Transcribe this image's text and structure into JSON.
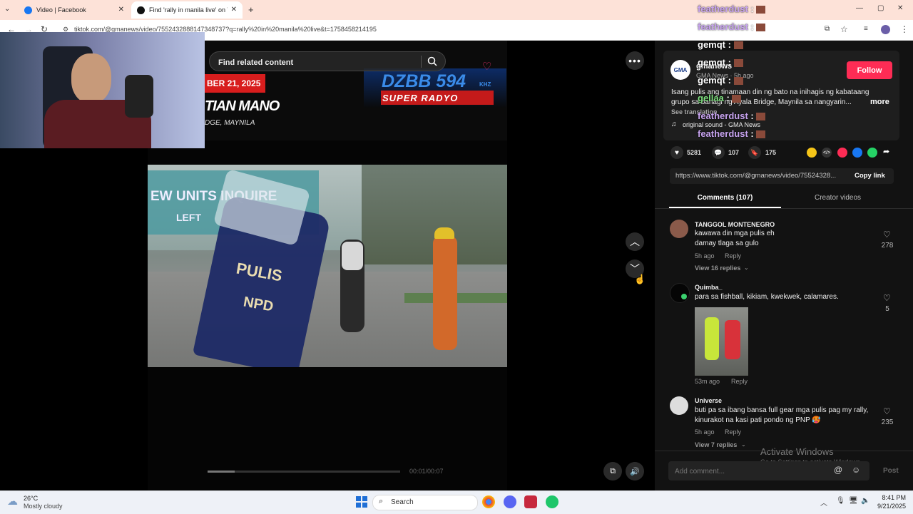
{
  "browser": {
    "tabs": [
      {
        "title": "Video | Facebook",
        "active": false
      },
      {
        "title": "Find 'rally in manila live' on TikTok",
        "active": true
      }
    ],
    "url": "tiktok.com/@gmanews/video/7552432888147348737?q=rally%20in%20manila%20live&t=1758458214195"
  },
  "video": {
    "search_placeholder": "Find related content",
    "overlay": {
      "date": "BER 21, 2025",
      "name": "TIAN MANO",
      "place": "DGE, MAYNILA",
      "station": "DZBB 594",
      "station_suffix": "KHZ",
      "station_sub": "SUPER RADYO"
    },
    "signs": {
      "store": "EW UNITS  INQUIRE",
      "store2": "LEFT",
      "shield": "PULIS",
      "badge": "NPD"
    },
    "time": "00:01/00:07"
  },
  "chat_overlay": [
    {
      "user": "featherdust",
      "color": "#c8a4f0"
    },
    {
      "user": "featherdust",
      "color": "#c8a4f0"
    },
    {
      "user": "gemqt",
      "color": "#ffffff"
    },
    {
      "user": "gemqt",
      "color": "#ffffff"
    },
    {
      "user": "gemqt",
      "color": "#ffffff"
    },
    {
      "user": "gellaa",
      "color": "#7ee07e"
    },
    {
      "user": "featherdust",
      "color": "#c8a4f0"
    },
    {
      "user": "featherdust",
      "color": "#c8a4f0"
    }
  ],
  "post": {
    "author": "gmanews",
    "author_sub": "GMA News · 5h ago",
    "follow_label": "Follow",
    "caption": "Isang pulis ang tinamaan din ng bato na inihagis ng kabataang grupo sa bahagi ng Ayala Bridge, Maynila sa nangyarin...",
    "more_label": "more",
    "see_translation": "See translation",
    "sound": "original sound - GMA News",
    "likes": "5281",
    "comments": "107",
    "saves": "175",
    "link": "https://www.tiktok.com/@gmanews/video/75524328...",
    "copy_label": "Copy link",
    "tabs": [
      "Comments (107)",
      "Creator videos"
    ]
  },
  "comments": [
    {
      "name": "TANGGOL MONTENEGRO",
      "text": "kawawa din mga pulis eh\ndamay tlaga sa gulo",
      "age": "5h ago",
      "reply": "Reply",
      "likes": "278",
      "replies": "View 16 replies"
    },
    {
      "name": "Quimba_",
      "text": "para sa fishball, kikiam, kwekwek, calamares.",
      "age": "53m ago",
      "reply": "Reply",
      "likes": "5",
      "replies": ""
    },
    {
      "name": "Universe",
      "text": "buti pa sa ibang bansa full gear mga pulis pag my rally, kinurakot na kasi pati pondo ng PNP 🥵",
      "age": "5h ago",
      "reply": "Reply",
      "likes": "235",
      "replies": "View 7 replies"
    }
  ],
  "comment_box": {
    "placeholder": "Add comment...",
    "post_label": "Post"
  },
  "activate": {
    "title": "Activate Windows",
    "sub": "Go to Settings to activate Windows."
  },
  "taskbar": {
    "temp": "26°C",
    "weather": "Mostly cloudy",
    "search": "Search",
    "time": "8:41 PM",
    "date": "9/21/2025"
  },
  "colors": {
    "accent": "#fe2c55",
    "panel": "#121212",
    "tabbar": "#fde2d8"
  }
}
